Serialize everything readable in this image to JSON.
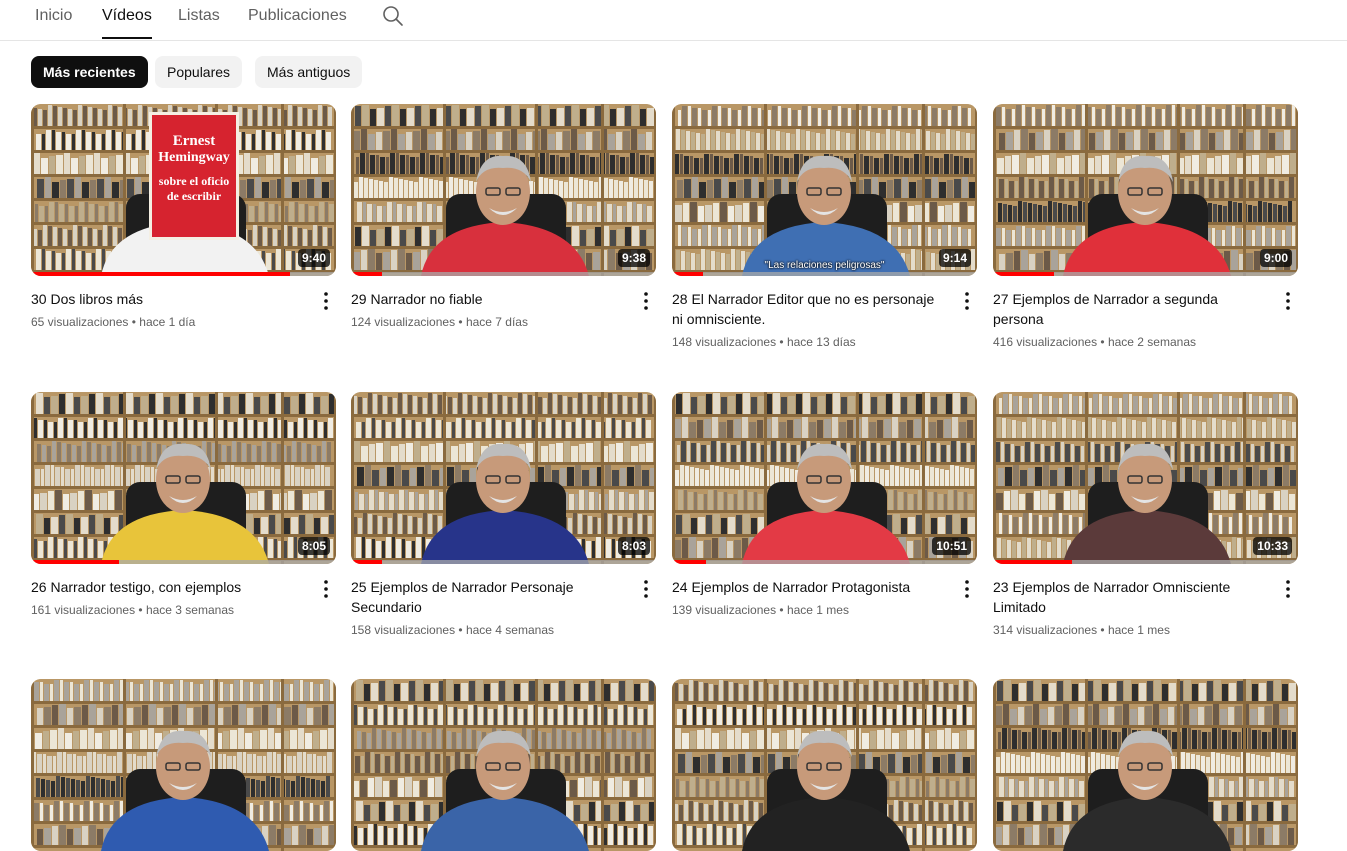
{
  "tabs": [
    {
      "label": "Inicio",
      "active": false
    },
    {
      "label": "Vídeos",
      "active": true
    },
    {
      "label": "Listas",
      "active": false
    },
    {
      "label": "Publicaciones",
      "active": false
    }
  ],
  "search_icon": "search-icon",
  "chips": [
    {
      "label": "Más recientes",
      "selected": true
    },
    {
      "label": "Populares",
      "selected": false
    },
    {
      "label": "Más antiguos",
      "selected": false
    }
  ],
  "videos": [
    {
      "title": "30 Dos libros más",
      "views": "65 visualizaciones",
      "age": "hace 1 día",
      "duration": "9:40",
      "watched": 0.85,
      "shirt": "#f2f2f2"
    },
    {
      "title": "29 Narrador no fiable",
      "views": "124 visualizaciones",
      "age": "hace 7 días",
      "duration": "9:38",
      "watched": 0.1,
      "shirt": "#d8303d"
    },
    {
      "title": "28 El Narrador Editor que no es personaje ni omnisciente.",
      "views": "148 visualizaciones",
      "age": "hace 13 días",
      "duration": "9:14",
      "watched": 0.1,
      "shirt": "#3f6fb3",
      "caption": "\"Las relaciones peligrosas\""
    },
    {
      "title": "27 Ejemplos de Narrador a segunda persona",
      "views": "416 visualizaciones",
      "age": "hace 2 semanas",
      "duration": "9:00",
      "watched": 0.2,
      "shirt": "#e0303a"
    },
    {
      "title": "26 Narrador testigo, con ejemplos",
      "views": "161 visualizaciones",
      "age": "hace 3 semanas",
      "duration": "8:05",
      "watched": 0.29,
      "shirt": "#e8c43a"
    },
    {
      "title": "25 Ejemplos de Narrador Personaje Secundario",
      "views": "158 visualizaciones",
      "age": "hace 4 semanas",
      "duration": "8:03",
      "watched": 0.1,
      "shirt": "#27348a"
    },
    {
      "title": "24 Ejemplos de Narrador Protagonista",
      "views": "139 visualizaciones",
      "age": "hace 1 mes",
      "duration": "10:51",
      "watched": 0.11,
      "shirt": "#e33a45"
    },
    {
      "title": "23 Ejemplos de Narrador Omnisciente Limitado",
      "views": "314 visualizaciones",
      "age": "hace 1 mes",
      "duration": "10:33",
      "watched": 0.26,
      "shirt": "#5b3a3a"
    },
    {
      "title": "",
      "views": "",
      "age": "",
      "duration": "",
      "watched": 0,
      "shirt": "#2f5bb0"
    },
    {
      "title": "",
      "views": "",
      "age": "",
      "duration": "",
      "watched": 0,
      "shirt": "#3a64a8"
    },
    {
      "title": "",
      "views": "",
      "age": "",
      "duration": "",
      "watched": 0,
      "shirt": "#222222"
    },
    {
      "title": "",
      "views": "",
      "age": "",
      "duration": "",
      "watched": 0,
      "shirt": "#2b2b2b"
    }
  ],
  "thumbnail_overlay_text": {
    "book_cover_line1": "Ernest",
    "book_cover_line2": "Hemingway",
    "book_cover_line3": "sobre el oficio",
    "book_cover_line4": "de escribir"
  }
}
